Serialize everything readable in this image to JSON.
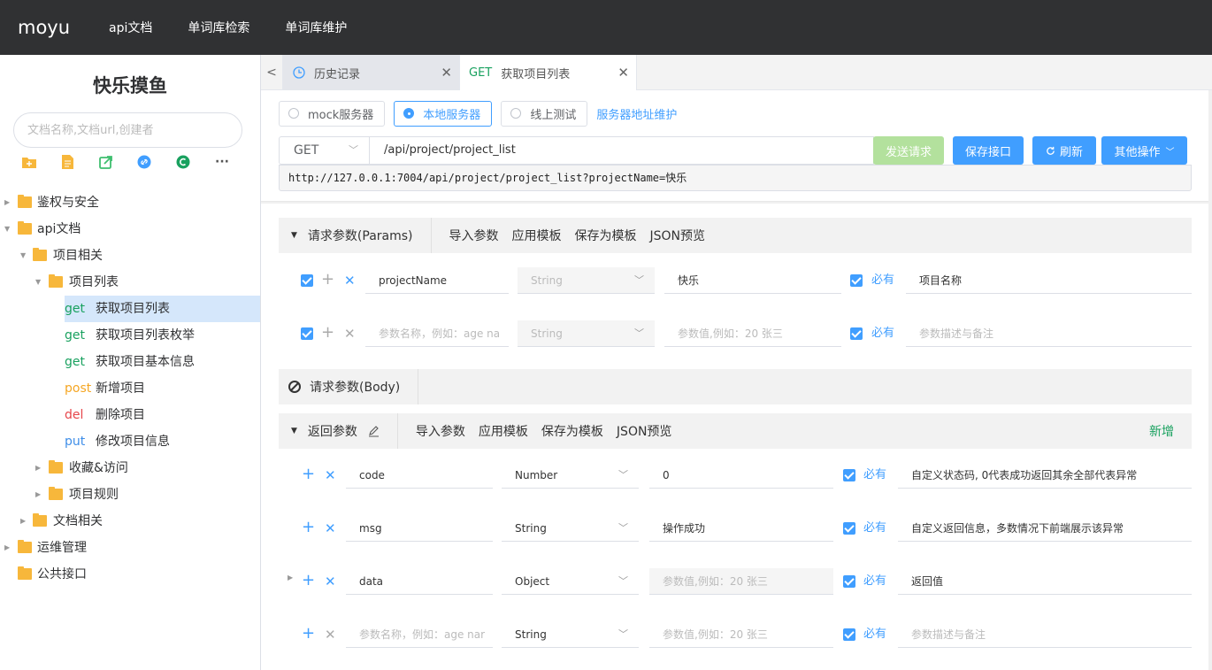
{
  "topbar": {
    "brand": "moyu",
    "nav": [
      "api文档",
      "单词库检索",
      "单词库维护"
    ]
  },
  "sidebar": {
    "title": "快乐摸鱼",
    "search_placeholder": "文档名称,文档url,创建者",
    "tree": [
      {
        "label": "鉴权与安全"
      },
      {
        "label": "api文档"
      },
      {
        "label": "项目相关"
      },
      {
        "label": "项目列表"
      },
      {
        "method": "get",
        "label": "获取项目列表"
      },
      {
        "method": "get",
        "label": "获取项目列表枚举"
      },
      {
        "method": "get",
        "label": "获取项目基本信息"
      },
      {
        "method": "post",
        "label": "新增项目"
      },
      {
        "method": "del",
        "label": "删除项目"
      },
      {
        "method": "put",
        "label": "修改项目信息"
      },
      {
        "label": "收藏&访问"
      },
      {
        "label": "项目规则"
      },
      {
        "label": "文档相关"
      },
      {
        "label": "运维管理"
      },
      {
        "label": "公共接口"
      }
    ]
  },
  "tabs": [
    {
      "label": "历史记录"
    },
    {
      "method": "GET",
      "label": "获取项目列表"
    }
  ],
  "servers": {
    "options": [
      "mock服务器",
      "本地服务器",
      "线上测试"
    ],
    "selected": "本地服务器",
    "maintain_link": "服务器地址维护"
  },
  "request": {
    "method": "GET",
    "path": "/api/project/project_list",
    "full_url": "http://127.0.0.1:7004/api/project/project_list?projectName=快乐",
    "buttons": {
      "send": "发送请求",
      "save": "保存接口",
      "refresh": "刷新",
      "more": "其他操作"
    }
  },
  "params": {
    "title": "请求参数(Params)",
    "actions": [
      "导入参数",
      "应用模板",
      "保存为模板",
      "JSON预览"
    ],
    "rows": [
      {
        "name": "projectName",
        "type": "String",
        "value": "快乐",
        "required": "必有",
        "desc": "项目名称"
      },
      {
        "name_placeholder": "参数名称，例如：age na",
        "type": "String",
        "value_placeholder": "参数值,例如：20 张三",
        "required": "必有",
        "desc_placeholder": "参数描述与备注"
      }
    ]
  },
  "body": {
    "title": "请求参数(Body)"
  },
  "response": {
    "title": "返回参数",
    "actions": [
      "导入参数",
      "应用模板",
      "保存为模板",
      "JSON预览"
    ],
    "add": "新增",
    "rows": [
      {
        "name": "code",
        "type": "Number",
        "value": "0",
        "required": "必有",
        "desc": "自定义状态码, 0代表成功返回其余全部代表异常"
      },
      {
        "name": "msg",
        "type": "String",
        "value": "操作成功",
        "required": "必有",
        "desc": "自定义返回信息，多数情况下前端展示该异常"
      },
      {
        "name": "data",
        "type": "Object",
        "value_placeholder": "参数值,例如：20 张三",
        "required": "必有",
        "desc": "返回值"
      },
      {
        "name_placeholder": "参数名称，例如：age nar",
        "type": "String",
        "value_placeholder": "参数值,例如：20 张三",
        "required": "必有",
        "desc_placeholder": "参数描述与备注"
      }
    ]
  },
  "colors": {
    "topbar": "#303133",
    "primary": "#409eff",
    "send_disabled": "#b3e19d",
    "folder": "#f7b73b",
    "get": "#19a15f",
    "post": "#f5a623",
    "del": "#e6454a",
    "put": "#3f8ee8"
  }
}
